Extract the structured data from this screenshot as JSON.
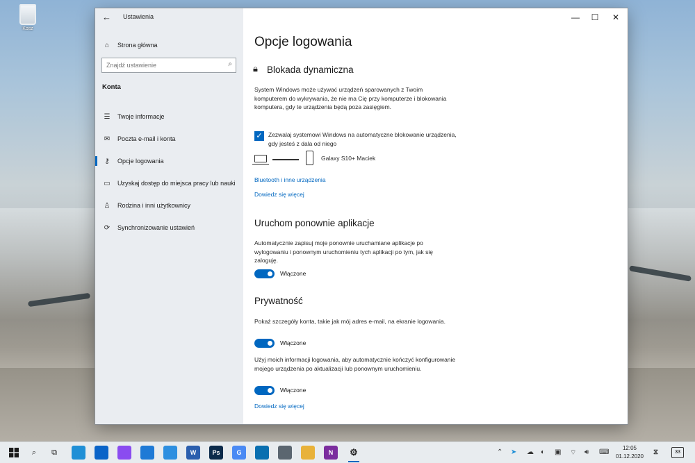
{
  "desktop": {
    "recycle_bin_label": "Kosz"
  },
  "window": {
    "title": "Ustawienia",
    "controls": {
      "minimize": "—",
      "maximize": "☐",
      "close": "✕"
    }
  },
  "sidebar": {
    "home_label": "Strona główna",
    "search_placeholder": "Znajdź ustawienie",
    "section": "Konta",
    "items": [
      {
        "label": "Twoje informacje",
        "icon": "person-card-icon"
      },
      {
        "label": "Poczta e-mail i konta",
        "icon": "mail-icon"
      },
      {
        "label": "Opcje logowania",
        "icon": "key-icon",
        "active": true
      },
      {
        "label": "Uzyskaj dostęp do miejsca pracy lub nauki",
        "icon": "briefcase-icon"
      },
      {
        "label": "Rodzina i inni użytkownicy",
        "icon": "person-add-icon"
      },
      {
        "label": "Synchronizowanie ustawień",
        "icon": "sync-icon"
      }
    ]
  },
  "content": {
    "page_title": "Opcje logowania",
    "dynamic_lock": {
      "heading": "Blokada dynamiczna",
      "description": "System Windows może używać urządzeń sparowanych z Twoim komputerem do wykrywania, że nie ma Cię przy komputerze i blokowania komputera, gdy te urządzenia będą poza zasięgiem.",
      "checkbox_label": "Zezwalaj systemowi Windows na automatyczne blokowanie urządzenia, gdy jesteś z dala od niego",
      "checkbox_checked": true,
      "device_name": "Galaxy S10+ Maciek",
      "link_bluetooth": "Bluetooth i inne urządzenia",
      "link_more": "Dowiedz się więcej"
    },
    "restart_apps": {
      "heading": "Uruchom ponownie aplikacje",
      "description": "Automatycznie zapisuj moje ponownie uruchamiane aplikacje po wylogowaniu i ponownym uruchomieniu tych aplikacji po tym, jak się zaloguję.",
      "toggle_label": "Włączone",
      "toggle_on": true
    },
    "privacy": {
      "heading": "Prywatność",
      "description1": "Pokaż szczegóły konta, takie jak mój adres e-mail, na ekranie logowania.",
      "toggle1_label": "Włączone",
      "description2": "Użyj moich informacji logowania, aby automatycznie kończyć konfigurowanie mojego urządzenia po aktualizacji lub ponownym uruchomieniu.",
      "toggle2_label": "Włączone",
      "link_more": "Dowiedz się więcej"
    }
  },
  "taskbar": {
    "apps": [
      {
        "name": "edge-icon",
        "color": "#1f8fd6"
      },
      {
        "name": "mail-icon",
        "color": "#0a64c8"
      },
      {
        "name": "messenger-icon",
        "color": "#8a4cf0"
      },
      {
        "name": "photos-icon",
        "color": "#1e7ad6"
      },
      {
        "name": "phone-icon",
        "color": "#2d8fe0"
      },
      {
        "name": "word-icon",
        "color": "#2b5fae",
        "text": "W"
      },
      {
        "name": "photoshop-icon",
        "color": "#0b2a4a",
        "text": "Ps"
      },
      {
        "name": "translate-icon",
        "color": "#4a8af4",
        "text": "G"
      },
      {
        "name": "trello-icon",
        "color": "#0a6fb0"
      },
      {
        "name": "calculator-icon",
        "color": "#5b6670"
      },
      {
        "name": "folder-icon",
        "color": "#e8b23a"
      },
      {
        "name": "onenote-icon",
        "color": "#7b2d9e",
        "text": "N"
      },
      {
        "name": "settings-icon",
        "color": "#e8ecef",
        "text": "⚙"
      }
    ],
    "notification_count": "33",
    "time": "12:05",
    "date": "01.12.2020"
  }
}
